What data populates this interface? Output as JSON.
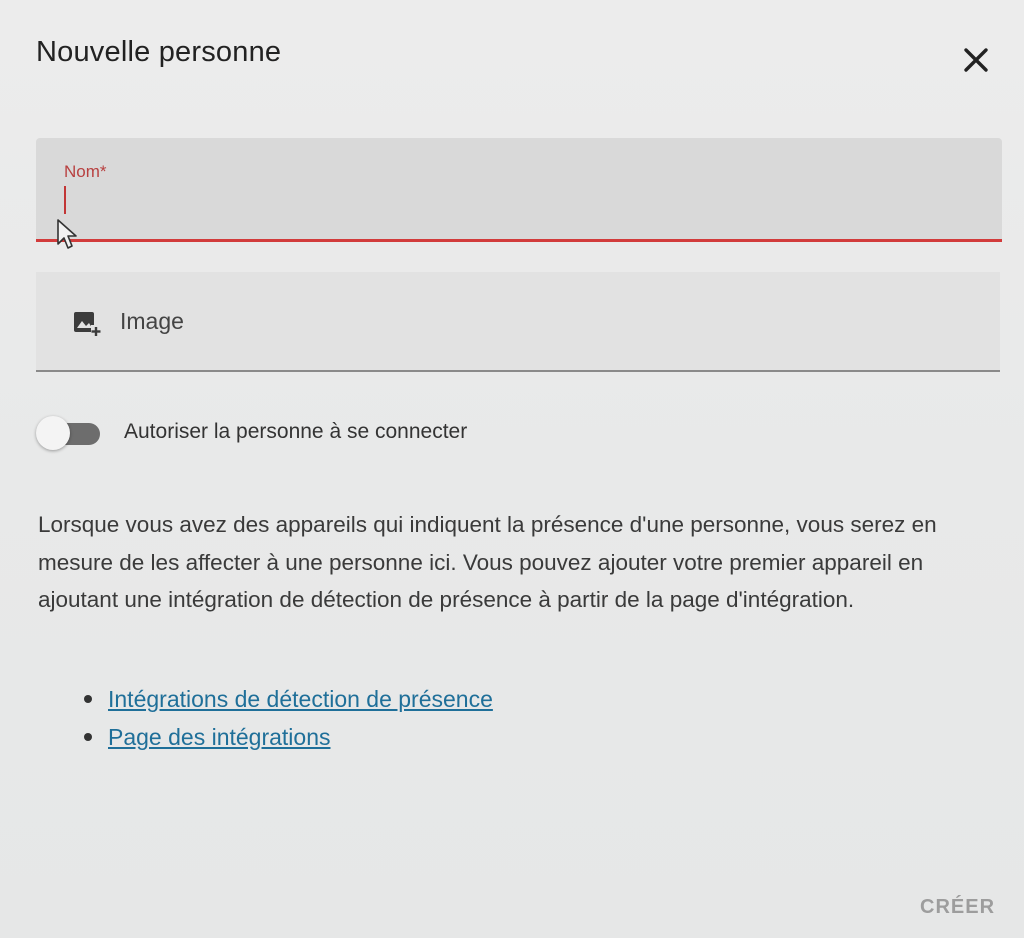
{
  "dialog": {
    "title": "Nouvelle personne",
    "close_icon": "close-icon"
  },
  "form": {
    "name_field": {
      "label": "Nom*",
      "value": "",
      "accent_color": "#d23b3b"
    },
    "image_field": {
      "label": "Image",
      "icon": "add-image-icon"
    },
    "login_toggle": {
      "label": "Autoriser la personne à se connecter",
      "checked": false
    }
  },
  "description": {
    "text": "Lorsque vous avez des appareils qui indiquent la présence d'une personne, vous serez en mesure de les affecter à une personne ici. Vous pouvez ajouter votre premier appareil en ajoutant une intégration de détection de présence à partir de la page d'intégration."
  },
  "links": [
    {
      "label": "Intégrations de détection de présence"
    },
    {
      "label": "Page des intégrations"
    }
  ],
  "actions": {
    "create_label": "CRÉER"
  },
  "colors": {
    "link": "#1f6f99",
    "error": "#d23b3b",
    "disabled": "#9d9d9d"
  }
}
